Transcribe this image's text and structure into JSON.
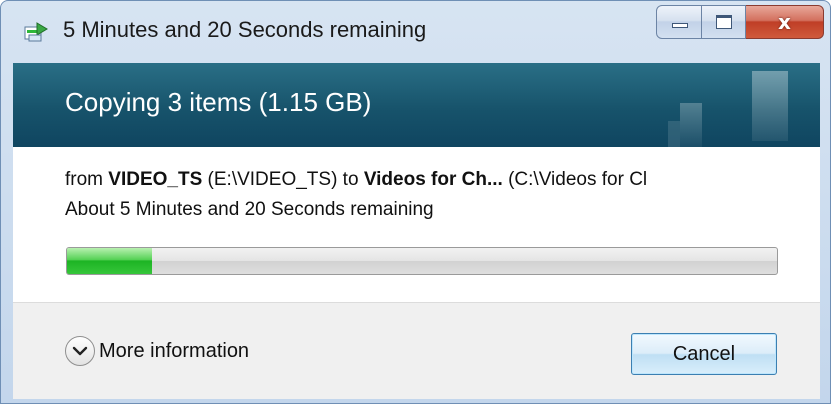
{
  "window": {
    "title": "5 Minutes and 20 Seconds remaining",
    "app_icon": "copy-progress-icon",
    "controls": {
      "minimize": "minimize-icon",
      "maximize": "maximize-icon",
      "close": "close-icon",
      "close_glyph": "x"
    }
  },
  "header": {
    "title": "Copying 3 items (1.15 GB)",
    "accent_color": "#17536b"
  },
  "details": {
    "from_label": "from ",
    "source_name": "VIDEO_TS",
    "source_path": " (E:\\VIDEO_TS) to ",
    "dest_name": "Videos for Ch...",
    "dest_path": " (C:\\Videos for Cl",
    "time_remaining": "About 5 Minutes and 20 Seconds remaining"
  },
  "progress": {
    "fraction": 0.12,
    "fill_color": "#1db424"
  },
  "footer": {
    "more_info_label": "More information",
    "more_info_icon": "chevron-down-icon",
    "cancel_label": "Cancel"
  }
}
